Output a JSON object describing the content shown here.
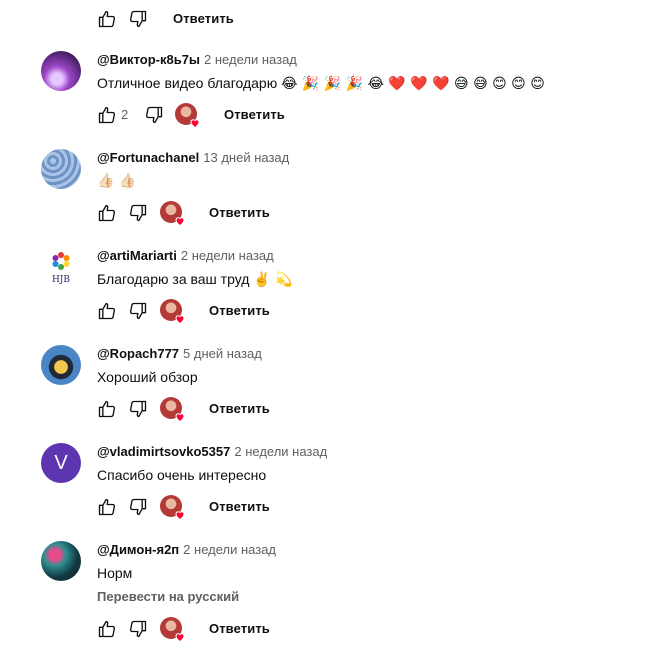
{
  "top_row": {
    "reply_label": "Ответить"
  },
  "comments": [
    {
      "handle": "@Виктор-к8ь7ы",
      "time": "2 недели назад",
      "text": "Отличное видео благодарю",
      "emoji": "😂 🎉 🎉 🎉 😂 ❤️ ❤️ ❤️ 😅 😅 😊 😊 😊",
      "likes": "2",
      "reply_label": "Ответить",
      "avatar_color": "#6b3a9c"
    },
    {
      "handle": "@Fortunachanel",
      "time": "13 дней назад",
      "text": "",
      "emoji": "👍🏻 👍🏻",
      "likes": "",
      "reply_label": "Ответить",
      "avatar_color": "#8fb0d8"
    },
    {
      "handle": "@artiMariarti",
      "time": "2 недели назад",
      "text": "Благодарю за ваш труд",
      "emoji": "✌️ 💫",
      "likes": "",
      "reply_label": "Ответить",
      "avatar_logo_text": "HJB"
    },
    {
      "handle": "@Ropach777",
      "time": "5 дней назад",
      "text": "Хороший обзор",
      "emoji": "",
      "likes": "",
      "reply_label": "Ответить",
      "avatar_color": "#2e6da4"
    },
    {
      "handle": "@vladimirtsovko5357",
      "time": "2 недели назад",
      "text": "Спасибо очень интересно",
      "emoji": "",
      "likes": "",
      "reply_label": "Ответить",
      "avatar_letter": "V",
      "avatar_color": "#5e35b1"
    },
    {
      "handle": "@Димон-я2п",
      "time": "2 недели назад",
      "text": "Норм",
      "emoji": "",
      "translate_label": "Перевести на русский",
      "likes": "",
      "reply_label": "Ответить",
      "avatar_color": "#1f4f5a"
    }
  ],
  "icons": {
    "like": "thumb-up-icon",
    "dislike": "thumb-down-icon",
    "creator_heart": "creator-heart-icon"
  },
  "colors": {
    "text": "#0f0f0f",
    "secondary": "#606060",
    "heart": "#ff0033"
  }
}
